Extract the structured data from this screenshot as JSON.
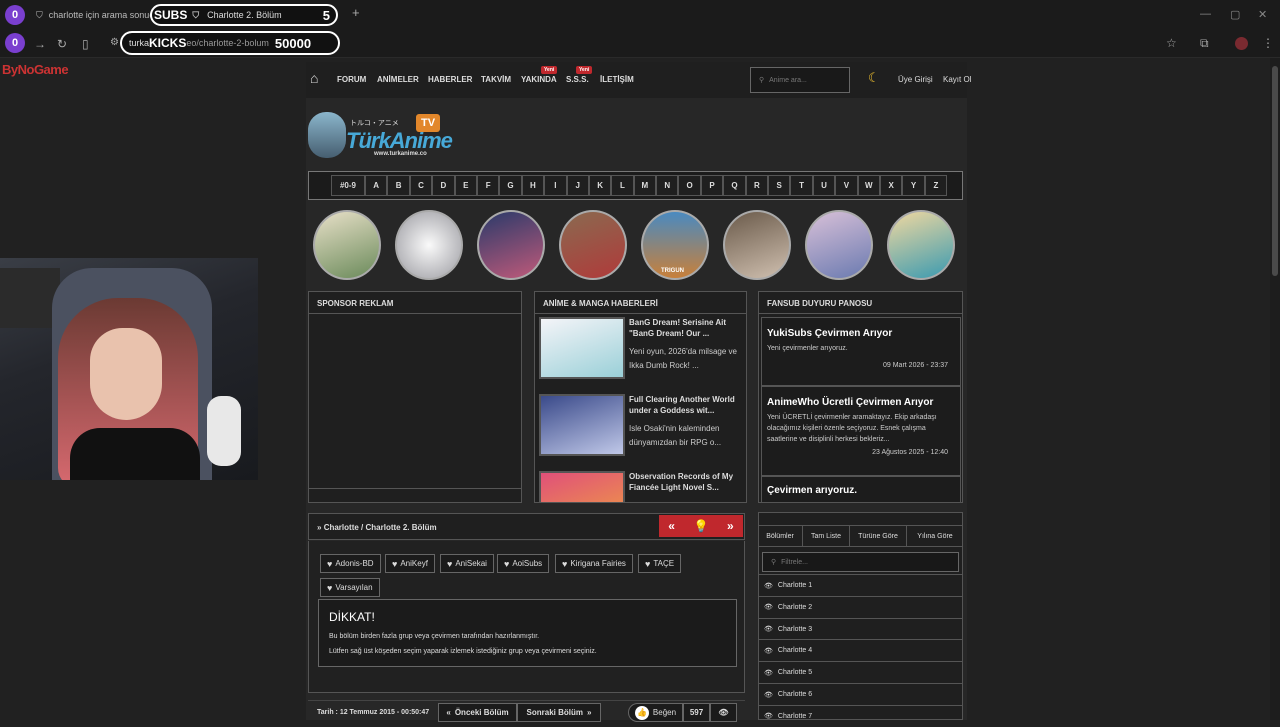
{
  "browser": {
    "tab1_title": "charlotte için arama sonuçları",
    "tab2_title": "Charlotte 2. Bölüm",
    "subs_label": "SUBS",
    "subs_count": "5",
    "kicks_label": "KICKS",
    "kicks_count": "50000",
    "badge_top": "0",
    "badge_addr": "0",
    "url_prefix": "turka",
    "url_suffix": "eo/charlotte-2-bolum",
    "new_tab_symbol": "+"
  },
  "overlay": {
    "brand": "ByNoGame"
  },
  "nav": {
    "items": [
      "FORUM",
      "ANİMELER",
      "HABERLER",
      "TAKVİM",
      "YAKINDA",
      "S.S.S.",
      "İLETİŞİM"
    ],
    "new_tag": "Yeni",
    "search_placeholder": "Anime ara...",
    "login": "Üye Girişi",
    "register": "Kayıt Ol"
  },
  "logo": {
    "title": "TürkAnime",
    "tv": "TV",
    "jp": "トルコ・アニメ",
    "url": "www.turkanime.co"
  },
  "alphabet": [
    "#0-9",
    "A",
    "B",
    "C",
    "D",
    "E",
    "F",
    "G",
    "H",
    "I",
    "J",
    "K",
    "L",
    "M",
    "N",
    "O",
    "P",
    "Q",
    "R",
    "S",
    "T",
    "U",
    "V",
    "W",
    "X",
    "Y",
    "Z"
  ],
  "featured_labels": {
    "trigun": "TRIGUN"
  },
  "panels": {
    "sponsor_title": "SPONSOR REKLAM",
    "news_title": "ANİME & MANGA HABERLERİ",
    "fansub_title": "FANSUB DUYURU PANOSU"
  },
  "news": [
    {
      "title": "BanG Dream! Serisine Ait \"BanG Dream! Our ...",
      "desc": "Yeni oyun, 2026'da milsage ve Ikka Dumb Rock! ..."
    },
    {
      "title": "Full Clearing Another World under a Goddess wit...",
      "desc": "Isle Osaki'nin kaleminden dünyamızdan bir RPG o..."
    },
    {
      "title": "Observation Records of My Fiancée Light Novel S...",
      "desc": ""
    }
  ],
  "fansub": [
    {
      "title": "YukiSubs Çevirmen Arıyor",
      "desc": "Yeni çevirmenler arıyoruz.",
      "date": "09 Mart 2026 - 23:37"
    },
    {
      "title": "AnimeWho Ücretli Çevirmen Arıyor",
      "desc": "Yeni ÜCRETLİ çevirmenler aramaktayız. Ekip arkadaşı olacağımız kişileri özenle seçiyoruz. Esnek çalışma saatlerine ve disiplinli herkesi bekleriz...",
      "date": "23 Ağustos 2025 - 12:40"
    },
    {
      "title": "Çevirmen arıyoruz.",
      "desc": "",
      "date": ""
    }
  ],
  "breadcrumb": {
    "anime": "Charlotte",
    "sep": "/",
    "episode": "Charlotte 2. Bölüm"
  },
  "groups": [
    "Adonis-BD",
    "AniKeyf",
    "AniSekai",
    "AoiSubs",
    "Kirigana Fairies",
    "TAÇE",
    "Varsayılan"
  ],
  "warning": {
    "title": "DİKKAT!",
    "line1": "Bu bölüm birden fazla grup veya çevirmen tarafından hazırlanmıştır.",
    "line2": "Lütfen sağ üst köşeden seçim yaparak izlemek istediğiniz grup veya çevirmeni seçiniz."
  },
  "footer": {
    "date_label": "Tarih : 12 Temmuz 2015 - 00:50:47",
    "prev": "Önceki Bölüm",
    "next": "Sonraki Bölüm",
    "like": "Beğen",
    "like_count": "597"
  },
  "sidebar": {
    "tabs": [
      "Bölümler",
      "Tam Liste",
      "Türüne Göre",
      "Yılına Göre"
    ],
    "filter_placeholder": "Filtrele...",
    "episodes": [
      "Charlotte 1",
      "Charlotte 2",
      "Charlotte 3",
      "Charlotte 4",
      "Charlotte 5",
      "Charlotte 6",
      "Charlotte 7"
    ]
  }
}
